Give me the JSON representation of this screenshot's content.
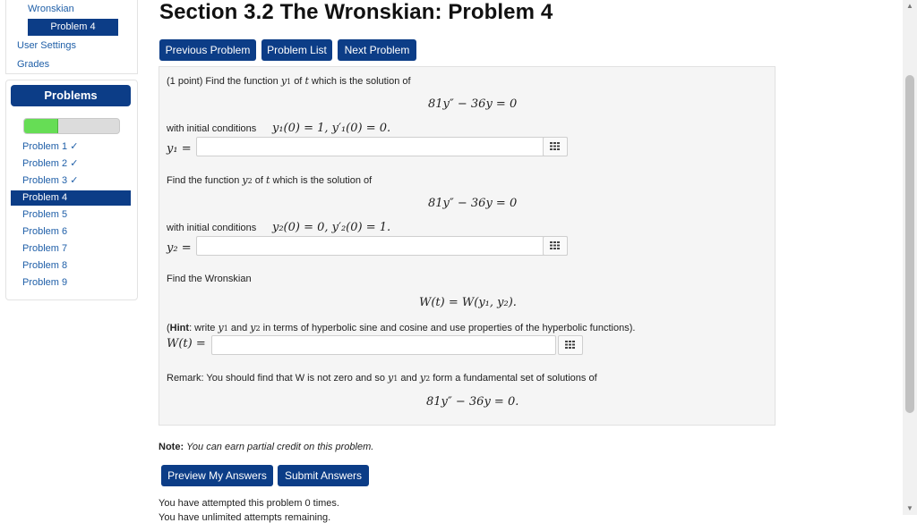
{
  "nav": {
    "wronskian_link": "Wronskian",
    "active_problem": "Problem 4",
    "user_settings": "User Settings",
    "grades": "Grades"
  },
  "problems_panel": {
    "header": "Problems",
    "progress_fraction": 0.35,
    "items": [
      {
        "label": "Problem 1",
        "done": true
      },
      {
        "label": "Problem 2",
        "done": true
      },
      {
        "label": "Problem 3",
        "done": true
      },
      {
        "label": "Problem 4",
        "done": false,
        "active": true
      },
      {
        "label": "Problem 5",
        "done": false
      },
      {
        "label": "Problem 6",
        "done": false
      },
      {
        "label": "Problem 7",
        "done": false
      },
      {
        "label": "Problem 8",
        "done": false
      },
      {
        "label": "Problem 9",
        "done": false
      }
    ]
  },
  "header": {
    "title": "Section 3.2 The Wronskian: Problem 4",
    "prev_button": "Previous Problem",
    "list_button": "Problem List",
    "next_button": "Next Problem"
  },
  "problem": {
    "intro1": "(1 point) Find the function",
    "intro1_tail": "which is the solution of",
    "intro2": "Find the function",
    "intro2_tail": "which is the solution of",
    "of_t": "of",
    "with_ic": "with initial conditions",
    "ode": "81y″ − 36y = 0",
    "ic1": "y₁(0) = 1,   y′₁(0) = 0.",
    "ic2": "y₂(0) = 0,   y′₂(0) = 1.",
    "y1_label": "y₁ =",
    "y2_label": "y₂ =",
    "find_w": "Find the Wronskian",
    "w_eq": "W(t) = W(y₁, y₂).",
    "hint_bold": "Hint",
    "hint_text": ": write",
    "hint_and": "and",
    "hint_rest": "in terms of hyperbolic sine and cosine and use properties of the hyperbolic functions).",
    "w_label": "W(t) =",
    "remark_a": "Remark: You should find that W is not zero and so",
    "remark_and": "and",
    "remark_b": "form a fundamental set of solutions of",
    "ode_final": "81y″ − 36y = 0.",
    "y1_value": "",
    "y2_value": "",
    "w_value": ""
  },
  "footer": {
    "note_label": "Note:",
    "note_text": "You can earn partial credit on this problem.",
    "preview_button": "Preview My Answers",
    "submit_button": "Submit Answers",
    "attempts": "You have attempted this problem 0 times.",
    "cutoff": "You have unlimited attempts remaining."
  },
  "colors": {
    "primary": "#0c3d87",
    "link": "#1f5fa8",
    "progress": "#66dd55"
  }
}
